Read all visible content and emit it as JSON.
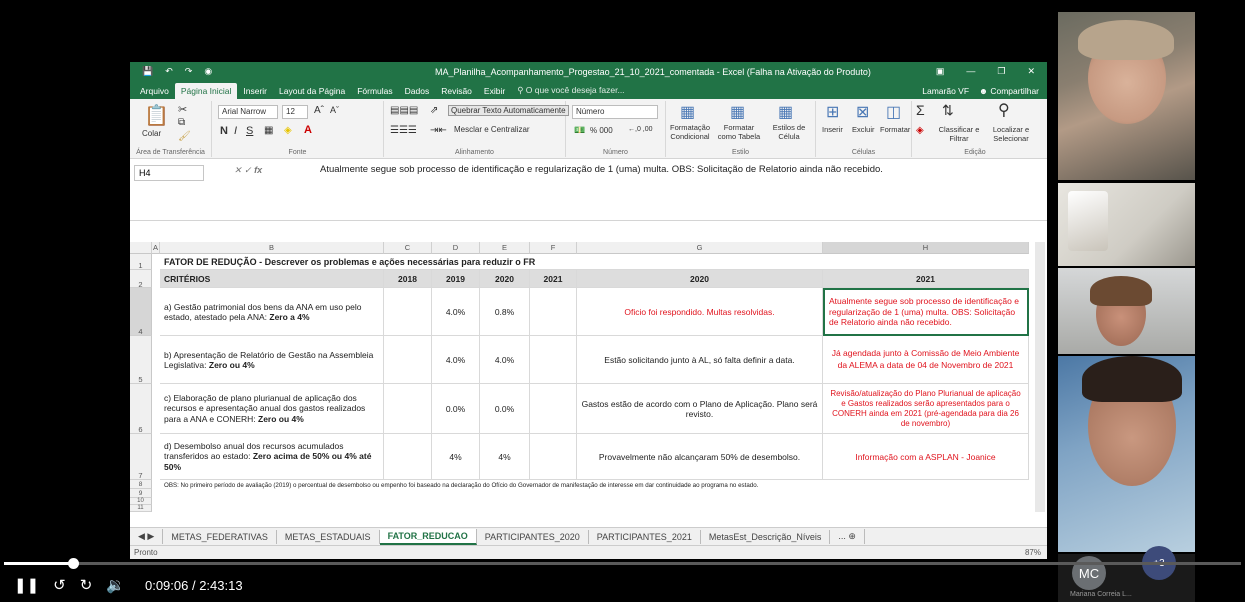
{
  "excel": {
    "title": "MA_Planilha_Acompanhamento_Progestao_21_10_2021_comentada - Excel (Falha na Ativação do Produto)",
    "menu_tabs": [
      "Arquivo",
      "Página Inicial",
      "Inserir",
      "Layout da Página",
      "Fórmulas",
      "Dados",
      "Revisão",
      "Exibir"
    ],
    "tell_me": "O que você deseja fazer...",
    "user": "Lamarão VF",
    "share": "Compartilhar",
    "ribbon": {
      "colar": "Colar",
      "font_name": "Arial Narrow",
      "font_size": "12",
      "wrap_text": "Quebrar Texto Automaticamente",
      "merge_center": "Mesclar e Centralizar",
      "number_format": "Número",
      "percent_etc": "% 000",
      "cond_format": "Formatação Condicional",
      "format_table": "Formatar como Tabela",
      "cell_styles": "Estilos de Célula",
      "insert": "Inserir",
      "delete": "Excluir",
      "format": "Formatar",
      "sort_filter": "Classificar e Filtrar",
      "find_select": "Localizar e Selecionar",
      "groups": [
        "Área de Transferência",
        "Fonte",
        "Alinhamento",
        "Número",
        "Estilo",
        "Células",
        "Edição"
      ]
    },
    "name_box": "H4",
    "formula": "Atualmente segue sob processo de identificação e regularização de 1 (uma) multa. OBS: Solicitação de Relatorio ainda não recebido.",
    "columns": [
      "A",
      "B",
      "C",
      "D",
      "E",
      "F",
      "G",
      "H"
    ],
    "row_numbers": [
      "1",
      "2",
      "4",
      "5",
      "6",
      "7",
      "8",
      "9",
      "10",
      "11"
    ],
    "title_row": "FATOR DE REDUÇÃO - Descrever os problemas e ações necessárias para reduzir o FR",
    "header": [
      "CRITÉRIOS",
      "2018",
      "2019",
      "2020",
      "2021",
      "2020",
      "2021"
    ],
    "rows": [
      {
        "crit_text": "a) Gestão patrimonial dos bens da ANA em uso pelo estado, atestado pela ANA: ",
        "crit_bold": "Zero a 4%",
        "y2019": "4.0%",
        "y2020": "0.8%",
        "g": "Oficio foi respondido. Multas resolvidas.",
        "h": "Atualmente segue sob processo de identificação e regularização de 1 (uma) multa. OBS: Solicitação de Relatorio ainda não recebido."
      },
      {
        "crit_text": "b) Apresentação de Relatório de Gestão na Assembleia Legislativa: ",
        "crit_bold": "Zero ou 4%",
        "y2019": "4.0%",
        "y2020": "4.0%",
        "g": "Estão solicitando junto à AL, só falta definir a data.",
        "h": "Já agendada junto à Comissão de Meio Ambiente da ALEMA a data de 04 de Novembro de 2021"
      },
      {
        "crit_text": "c) Elaboração de plano plurianual de aplicação dos recursos e apresentação anual dos gastos realizados para a ANA e CONERH: ",
        "crit_bold": "Zero ou 4%",
        "y2019": "0.0%",
        "y2020": "0.0%",
        "g": "Gastos estão de acordo com o Plano de Aplicação. Plano será revisto.",
        "h": "Revisão/atualização do Plano Plurianual de aplicação e Gastos realizados serão apresentados para o CONERH ainda em 2021 (pré-agendada para dia 26 de novembro)"
      },
      {
        "crit_text": "d) Desembolso anual dos recursos acumulados transferidos ao estado: ",
        "crit_bold": "Zero acima de 50% ou 4% até 50%",
        "y2019": "4%",
        "y2020": "4%",
        "g": "Provavelmente não alcançaram 50% de desembolso.",
        "h": "Informação com a ASPLAN - Joanice"
      }
    ],
    "obs": "OBS: No primeiro período de avaliação (2019) o percentual de desembolso ou empenho foi baseado na declaração do Ofício do Governador de manifestação de interesse em dar continuidade ao programa no estado.",
    "sheets": [
      "METAS_FEDERATIVAS",
      "METAS_ESTADUAIS",
      "FATOR_REDUCAO",
      "PARTICIPANTES_2020",
      "PARTICIPANTES_2021",
      "MetasEst_Descrição_Níveis"
    ],
    "active_sheet": "FATOR_REDUCAO",
    "status": "Pronto",
    "zoom": "87%"
  },
  "call": {
    "avatar_initials": "MC",
    "more_count": "+3",
    "participant_name": "Mariana Correia L..."
  },
  "player": {
    "time": "0:09:06 / 2:43:13",
    "progress": 0.056
  },
  "colors": {
    "excel_green": "#217346",
    "note_red": "#e0141e"
  }
}
